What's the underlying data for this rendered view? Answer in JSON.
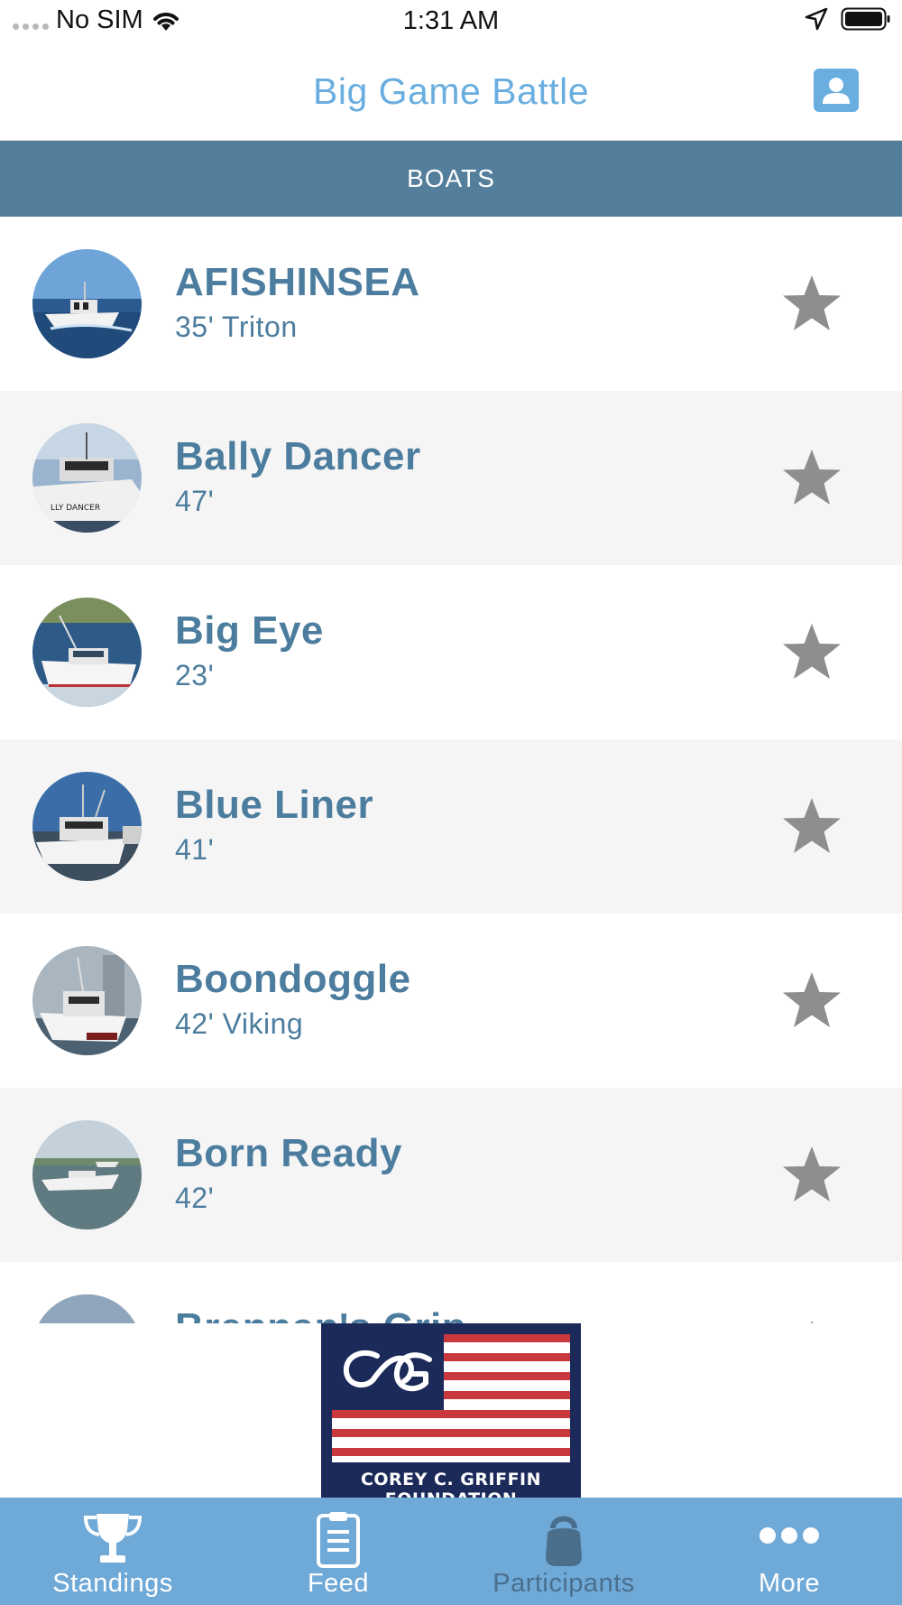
{
  "status_bar": {
    "carrier": "No SIM",
    "time": "1:31 AM"
  },
  "header": {
    "title": "Big Game Battle"
  },
  "section": {
    "label": "BOATS"
  },
  "boats": [
    {
      "name": "AFISHINSEA",
      "subtitle": "35' Triton"
    },
    {
      "name": "Bally Dancer",
      "subtitle": "47'"
    },
    {
      "name": "Big Eye",
      "subtitle": "23'"
    },
    {
      "name": "Blue Liner",
      "subtitle": "41'"
    },
    {
      "name": "Boondoggle",
      "subtitle": "42' Viking"
    },
    {
      "name": "Born Ready",
      "subtitle": "42'"
    },
    {
      "name": "Brennan's Grip",
      "subtitle": ""
    }
  ],
  "sponsor": {
    "logo_text": "COREY C. GRIFFIN FOUNDATION"
  },
  "tabs": [
    {
      "label": "Standings",
      "icon": "trophy-icon",
      "active": true
    },
    {
      "label": "Feed",
      "icon": "clipboard-icon",
      "active": true
    },
    {
      "label": "Participants",
      "icon": "kettlebell-icon",
      "active": false
    },
    {
      "label": "More",
      "icon": "more-dots-icon",
      "active": true
    }
  ],
  "colors": {
    "title_blue": "#6aaee0",
    "section_bar": "#547f9c",
    "boat_text": "#4c7d9e",
    "row_alt": "#f5f5f5",
    "star_gray": "#8e8e8e",
    "tab_bar": "#6fa9d7",
    "tab_inactive": "#4a6f8d",
    "logo_navy": "#1c2a5a",
    "logo_red": "#c8383d"
  }
}
